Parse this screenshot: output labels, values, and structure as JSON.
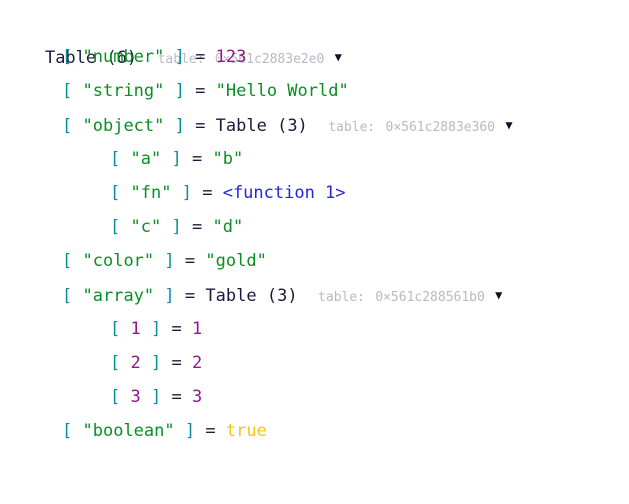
{
  "view": {
    "kind": "lua-table-inspector",
    "root_label": "Table",
    "root_count": "(6)",
    "addr_prefix": "table:",
    "collapse_glyph": "▼",
    "equals": "=",
    "bracket_open": "[",
    "bracket_close": "]"
  },
  "colors": {
    "background": "#ffffff",
    "table_label": "#1a1a3c",
    "bracket": "#0a8e96",
    "string": "#0a8f22",
    "number": "#8d1a8d",
    "function": "#2424e6",
    "boolean": "#f5c518",
    "address": "#b9b9c2",
    "triangle": "#101024"
  },
  "root": {
    "label": "Table",
    "count": "(6)",
    "addr_label": "table:",
    "addr": "0×561c2883e2e0",
    "triangle": "▼"
  },
  "rows": [
    {
      "level": 1,
      "key": "\"number\"",
      "key_type": "string",
      "value": "123",
      "value_type": "number"
    },
    {
      "level": 1,
      "key": "\"string\"",
      "key_type": "string",
      "value": "\"Hello World\"",
      "value_type": "string"
    },
    {
      "level": 1,
      "key": "\"object\"",
      "key_type": "string",
      "value": "Table",
      "value_type": "table",
      "count": "(3)",
      "addr_label": "table:",
      "addr": "0×561c2883e360",
      "triangle": "▼"
    },
    {
      "level": 2,
      "key": "\"a\"",
      "key_type": "string",
      "value": "\"b\"",
      "value_type": "string"
    },
    {
      "level": 2,
      "key": "\"fn\"",
      "key_type": "string",
      "value": "<function 1>",
      "value_type": "function"
    },
    {
      "level": 2,
      "key": "\"c\"",
      "key_type": "string",
      "value": "\"d\"",
      "value_type": "string"
    },
    {
      "level": 1,
      "key": "\"color\"",
      "key_type": "string",
      "value": "\"gold\"",
      "value_type": "string"
    },
    {
      "level": 1,
      "key": "\"array\"",
      "key_type": "string",
      "value": "Table",
      "value_type": "table",
      "count": "(3)",
      "addr_label": "table:",
      "addr": "0×561c288561b0",
      "triangle": "▼"
    },
    {
      "level": 2,
      "key": "1",
      "key_type": "number",
      "value": "1",
      "value_type": "number"
    },
    {
      "level": 2,
      "key": "2",
      "key_type": "number",
      "value": "2",
      "value_type": "number"
    },
    {
      "level": 2,
      "key": "3",
      "key_type": "number",
      "value": "3",
      "value_type": "number"
    },
    {
      "level": 1,
      "key": "\"boolean\"",
      "key_type": "string",
      "value": "true",
      "value_type": "boolean"
    }
  ]
}
